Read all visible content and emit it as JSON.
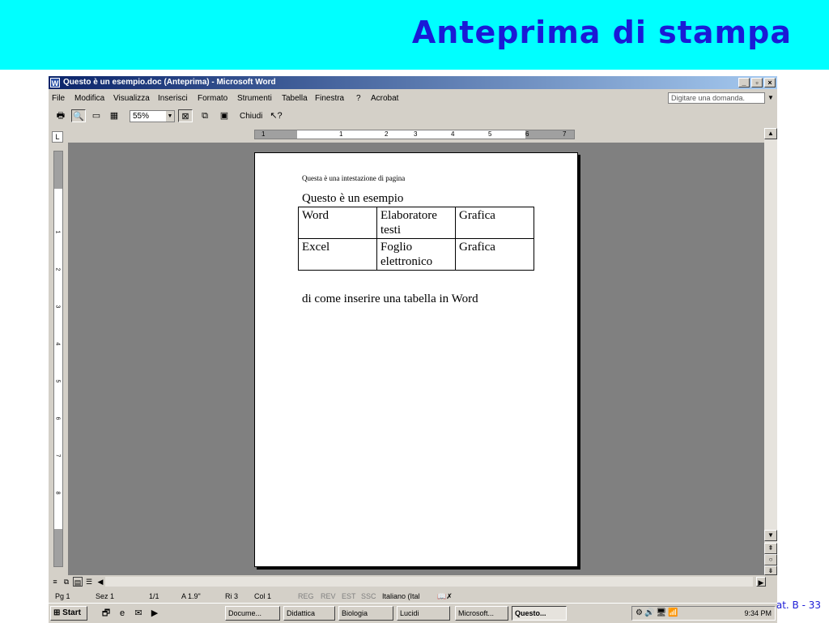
{
  "slide": {
    "title": "Anteprima di stampa",
    "footer": "at. B - 33"
  },
  "window": {
    "title": "Questo è un esempio.doc (Anteprima) - Microsoft Word",
    "controls": [
      "_",
      "▫",
      "×"
    ]
  },
  "menu": {
    "items": [
      "File",
      "Modifica",
      "Visualizza",
      "Inserisci",
      "Formato",
      "Strumenti",
      "Tabella",
      "Finestra",
      "?",
      "Acrobat"
    ],
    "ask_placeholder": "Digitare una domanda."
  },
  "toolbar": {
    "zoom": "55%",
    "close_label": "Chiudi"
  },
  "document": {
    "header_text": "Questa è una intestazione di pagina",
    "title": "Questo è un esempio",
    "table": [
      [
        "Word",
        "Elaboratore testi",
        "Grafica"
      ],
      [
        "Excel",
        "Foglio elettronico",
        "Grafica"
      ]
    ],
    "body": "di come inserire una tabella in Word"
  },
  "ruler": {
    "h_marks": [
      "1",
      "1",
      "2",
      "3",
      "4",
      "5",
      "6",
      "7"
    ],
    "v_marks": [
      "1",
      "2",
      "3",
      "4",
      "5",
      "6",
      "7",
      "8"
    ]
  },
  "status": {
    "page": "Pg 1",
    "section": "Sez 1",
    "pages": "1/1",
    "at": "A 1.9\"",
    "line": "Ri 3",
    "col": "Col 1",
    "modes": [
      "REG",
      "REV",
      "EST",
      "SSC"
    ],
    "language": "Italiano (Ital"
  },
  "taskbar": {
    "start": "Start",
    "tasks": [
      "Docume...",
      "Didattica",
      "Biologia",
      "Lucidi",
      "Microsoft...",
      "Questo..."
    ],
    "active_task": "Questo...",
    "clock": "9:34 PM"
  }
}
